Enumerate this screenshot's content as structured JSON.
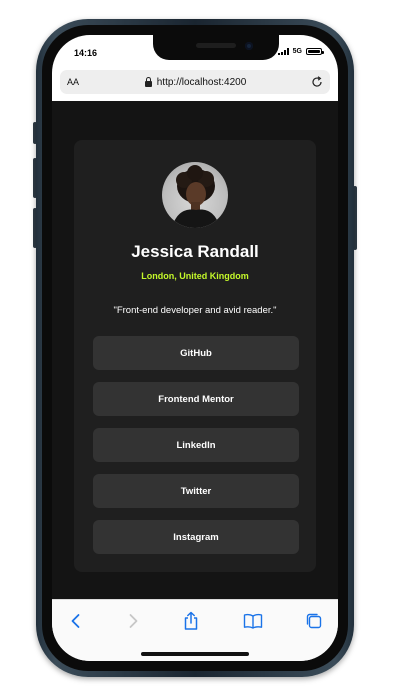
{
  "status_bar": {
    "time": "14:16",
    "network": "5G"
  },
  "browser": {
    "text_size_label": "AA",
    "url": "http://localhost:4200"
  },
  "profile": {
    "name": "Jessica Randall",
    "location": "London, United Kingdom",
    "bio": "\"Front-end developer and avid reader.\""
  },
  "links": [
    {
      "label": "GitHub"
    },
    {
      "label": "Frontend Mentor"
    },
    {
      "label": "LinkedIn"
    },
    {
      "label": "Twitter"
    },
    {
      "label": "Instagram"
    }
  ],
  "toolbar": {
    "icons": [
      "back-icon",
      "forward-icon",
      "share-icon",
      "bookmarks-icon",
      "tabs-icon"
    ]
  },
  "colors": {
    "page_background": "#141414",
    "card_background": "#1f1f1f",
    "button_background": "#333333",
    "accent": "#c4f82a",
    "toolbar_icon": "#1a73e8",
    "toolbar_icon_disabled": "#c7c7c7"
  }
}
